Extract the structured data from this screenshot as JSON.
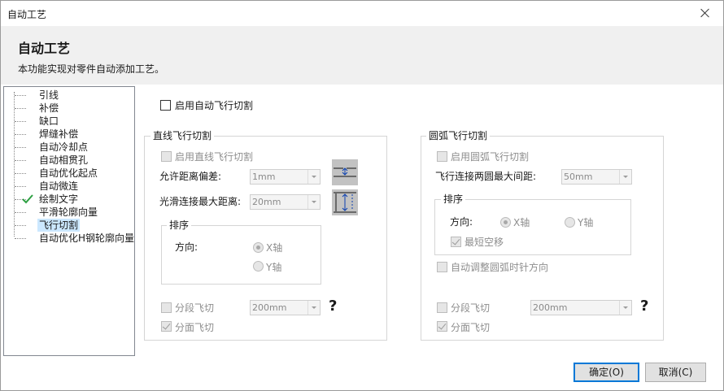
{
  "window": {
    "title": "自动工艺"
  },
  "header": {
    "title": "自动工艺",
    "description": "本功能实现对零件自动添加工艺。"
  },
  "tree": {
    "items": [
      {
        "label": "引线",
        "checked": false,
        "selected": false
      },
      {
        "label": "补偿",
        "checked": false,
        "selected": false
      },
      {
        "label": "缺口",
        "checked": false,
        "selected": false
      },
      {
        "label": "焊缝补偿",
        "checked": false,
        "selected": false
      },
      {
        "label": "自动冷却点",
        "checked": false,
        "selected": false
      },
      {
        "label": "自动相贯孔",
        "checked": false,
        "selected": false
      },
      {
        "label": "自动优化起点",
        "checked": false,
        "selected": false
      },
      {
        "label": "自动微连",
        "checked": false,
        "selected": false
      },
      {
        "label": "绘制文字",
        "checked": true,
        "selected": false
      },
      {
        "label": "平滑轮廓向量",
        "checked": false,
        "selected": false
      },
      {
        "label": "飞行切割",
        "checked": false,
        "selected": true
      },
      {
        "label": "自动优化H钢轮廓向量",
        "checked": false,
        "selected": false
      }
    ]
  },
  "main": {
    "enable_auto_fly": "启用自动飞行切割",
    "line_group": {
      "title": "直线飞行切割",
      "enable": "启用直线飞行切割",
      "tolerance_label": "允许距离偏差:",
      "tolerance_value": "1mm",
      "max_dist_label": "光滑连接最大距离:",
      "max_dist_value": "20mm",
      "sort_title": "排序",
      "direction_label": "方向:",
      "x_axis": "X轴",
      "y_axis": "Y轴",
      "segment_label": "分段飞切",
      "segment_value": "200mm",
      "face_label": "分面飞切",
      "help": "?"
    },
    "arc_group": {
      "title": "圆弧飞行切割",
      "enable": "启用圆弧飞行切割",
      "max_gap_label": "飞行连接两圆最大间距:",
      "max_gap_value": "50mm",
      "sort_title": "排序",
      "direction_label": "方向:",
      "x_axis": "X轴",
      "y_axis": "Y轴",
      "shortest_label": "最短空移",
      "auto_adjust_label": "自动调整圆弧时针方向",
      "segment_label": "分段飞切",
      "segment_value": "200mm",
      "face_label": "分面飞切",
      "help": "?"
    }
  },
  "footer": {
    "ok": "确定(O)",
    "cancel": "取消(C)"
  },
  "icons": {
    "close": "close-icon",
    "checkmark": "checkmark-icon"
  },
  "colors": {
    "header_bg": "#f0f0f0",
    "selection": "#cce8ff",
    "check_green": "#2ea043",
    "primary_border": "#0078d7"
  }
}
